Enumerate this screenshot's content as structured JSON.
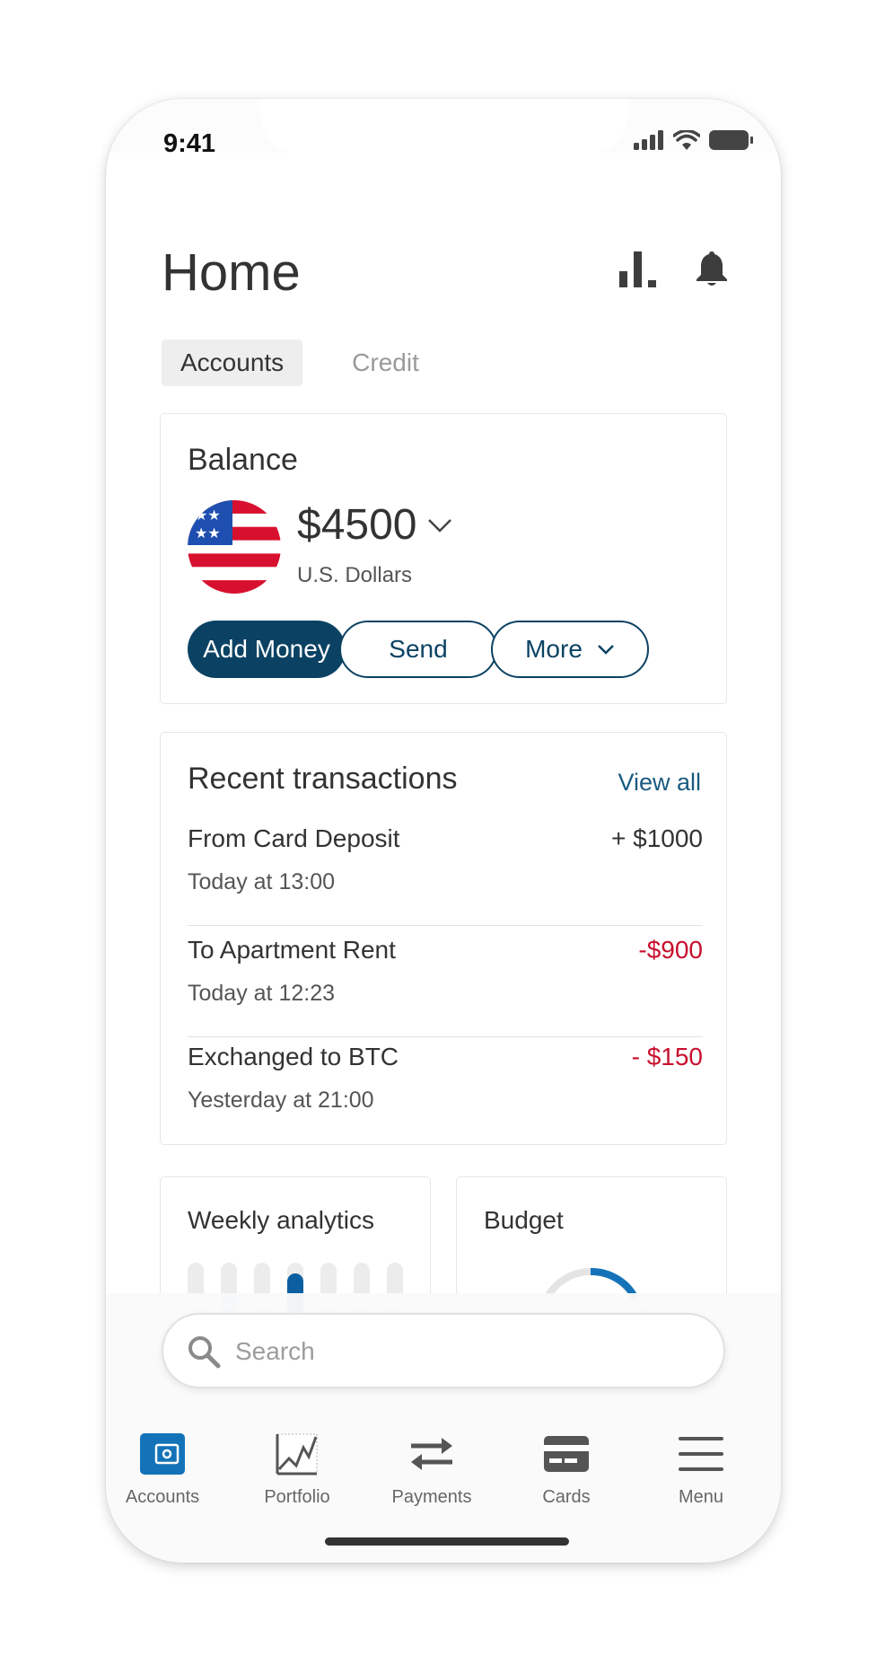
{
  "status_bar": {
    "time": "9:41"
  },
  "header": {
    "title": "Home",
    "icons": [
      "chart-icon",
      "bell-icon"
    ]
  },
  "tabs": [
    {
      "label": "Accounts",
      "active": true
    },
    {
      "label": "Credit",
      "active": false
    }
  ],
  "balance": {
    "title": "Balance",
    "amount": "$4500",
    "currency": "U.S. Dollars",
    "flag": "us-flag",
    "actions": {
      "add_money": "Add Money",
      "send": "Send",
      "more": "More"
    }
  },
  "transactions": {
    "title": "Recent transactions",
    "view_all": "View all",
    "items": [
      {
        "name": "From Card Deposit",
        "time": "Today at 13:00",
        "amount": "+ $1000"
      },
      {
        "name": "To Apartment Rent",
        "time": "Today at 12:23",
        "amount": "-$900"
      },
      {
        "name": "Exchanged to BTC",
        "time": "Yesterday at 21:00",
        "amount": "- $150"
      }
    ]
  },
  "widgets": {
    "analytics_title": "Weekly analytics",
    "budget_title": "Budget"
  },
  "search": {
    "placeholder": "Search"
  },
  "nav": [
    {
      "label": "Accounts",
      "icon": "wallet-icon",
      "active": true
    },
    {
      "label": "Portfolio",
      "icon": "portfolio-chart-icon",
      "active": false
    },
    {
      "label": "Payments",
      "icon": "transfer-arrows-icon",
      "active": false
    },
    {
      "label": "Cards",
      "icon": "card-icon",
      "active": false
    },
    {
      "label": "Menu",
      "icon": "hamburger-icon",
      "active": false
    }
  ],
  "colors": {
    "primary": "#0b4263",
    "negative": "#c8102e",
    "nav_active": "#1473b8",
    "link": "#1a5a80"
  }
}
